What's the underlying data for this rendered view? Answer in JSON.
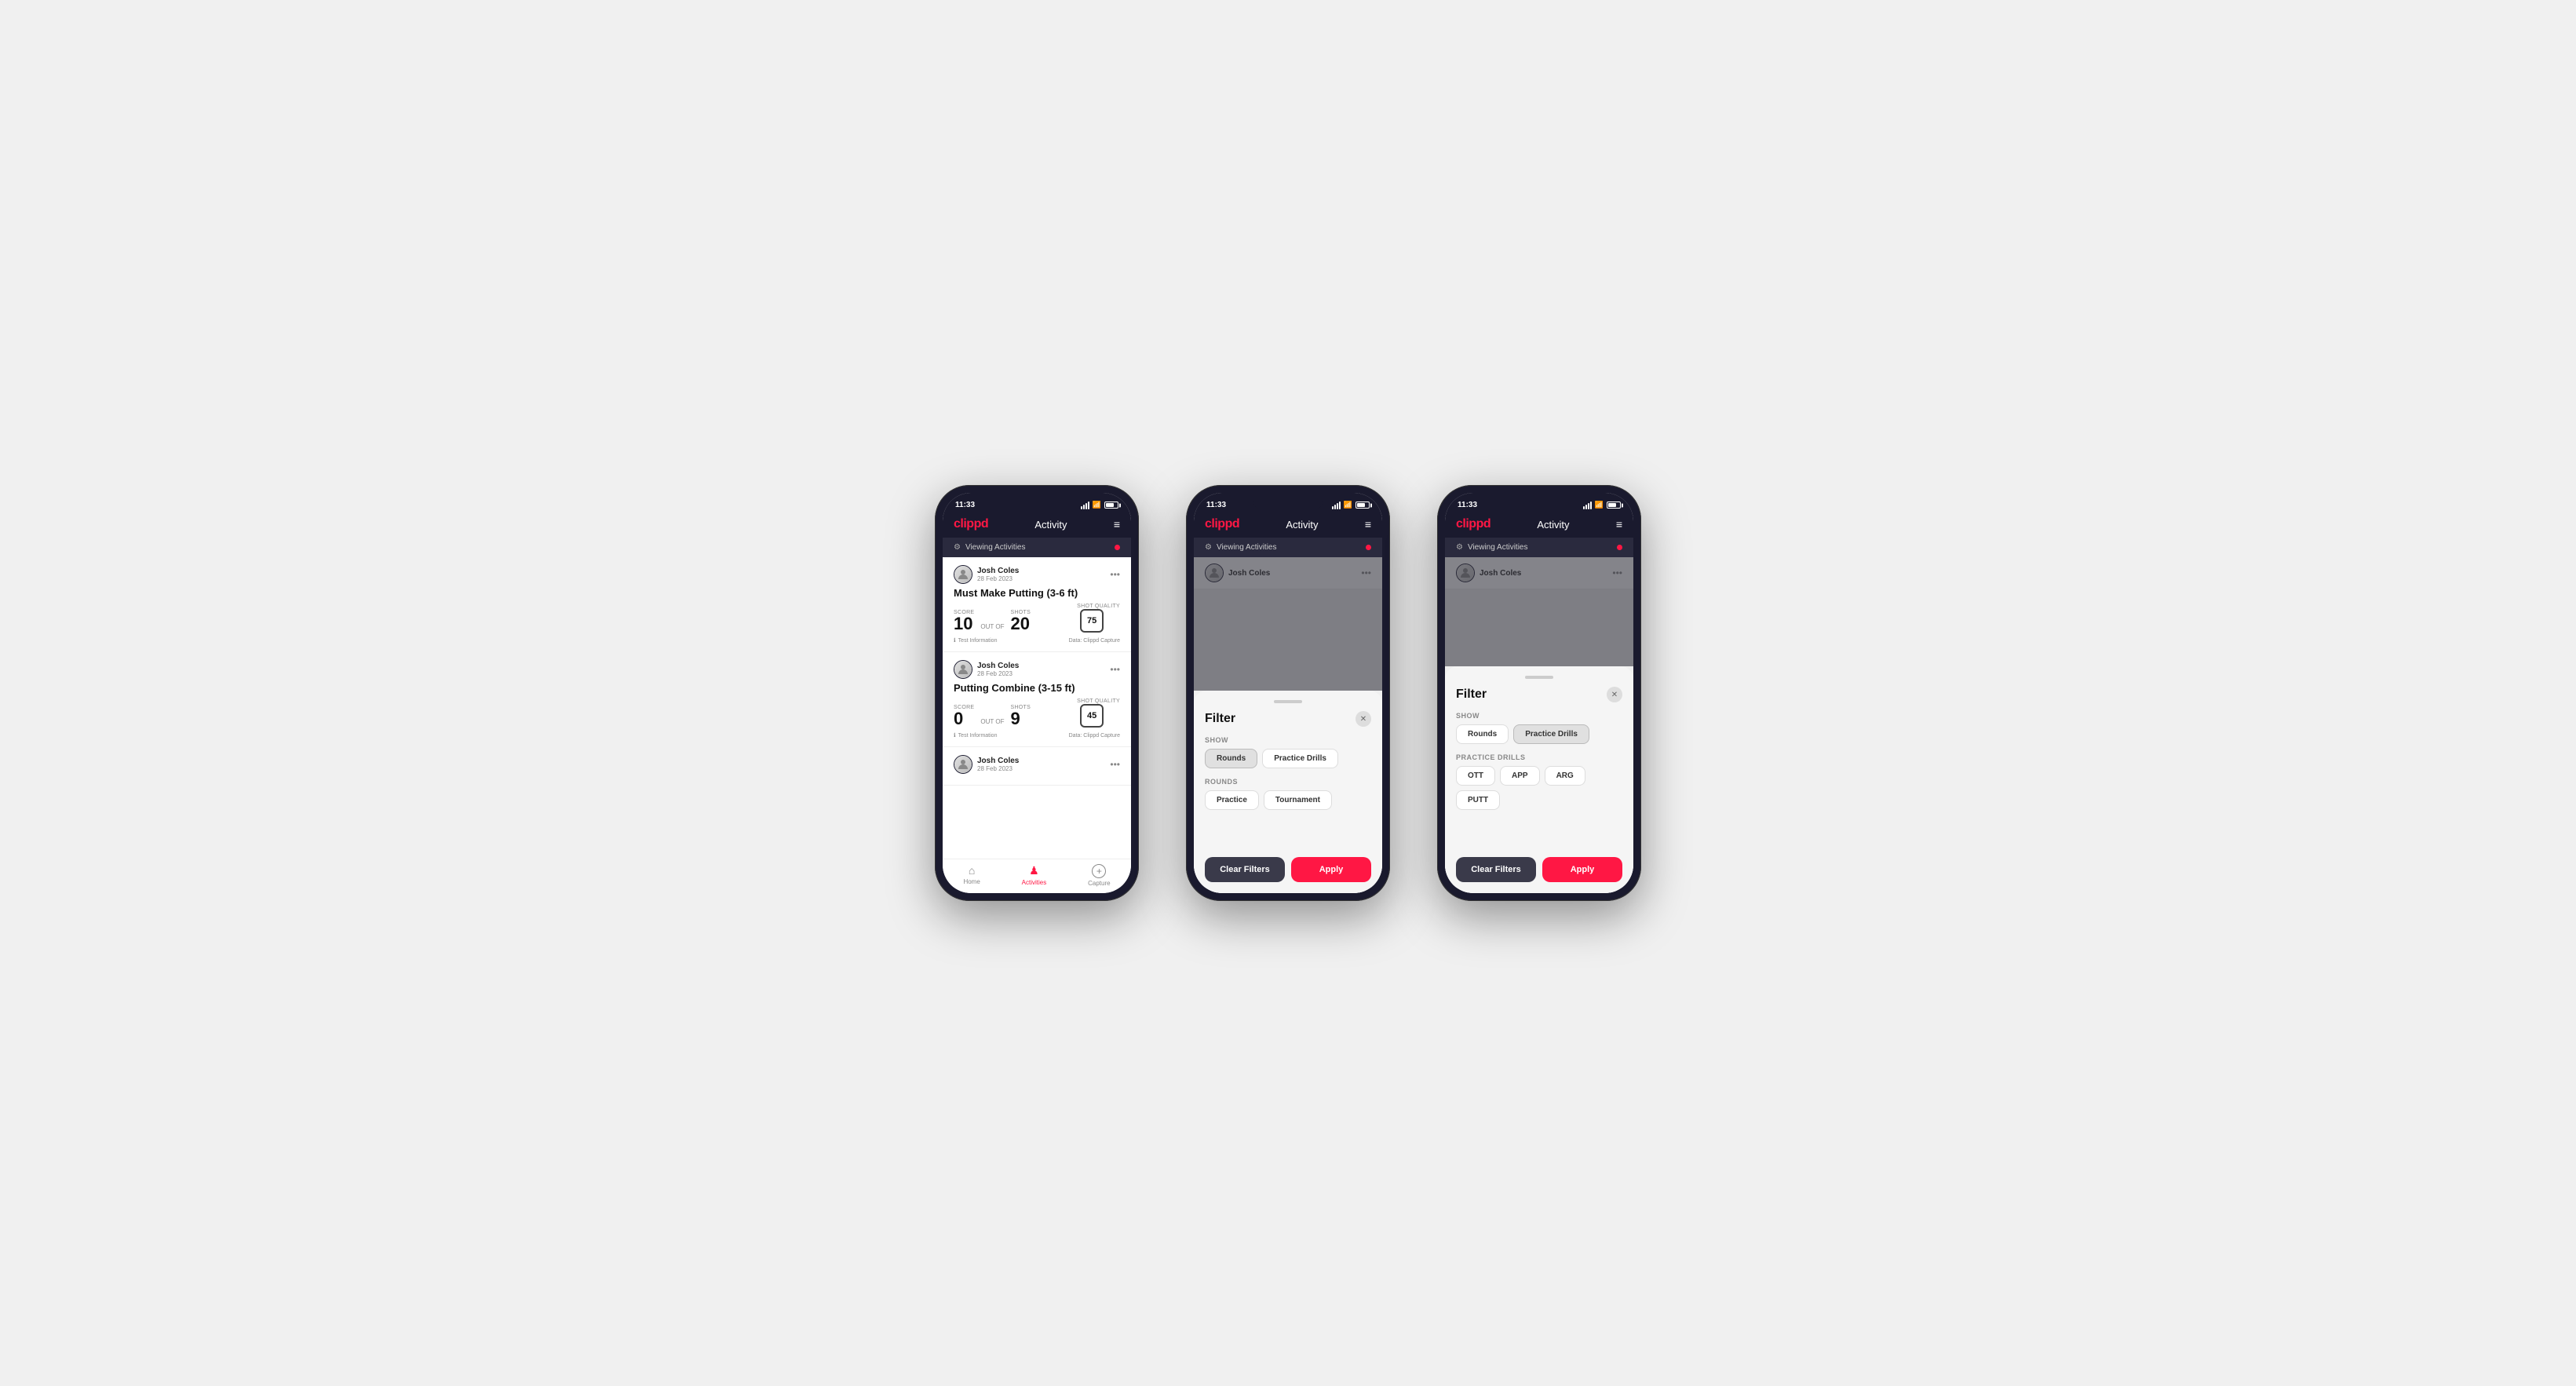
{
  "phones": [
    {
      "id": "phone1",
      "time": "11:33",
      "header": {
        "logo": "clippd",
        "title": "Activity",
        "menu": "≡"
      },
      "viewing_bar": "Viewing Activities",
      "activities": [
        {
          "user": "Josh Coles",
          "date": "28 Feb 2023",
          "title": "Must Make Putting (3-6 ft)",
          "score_label": "Score",
          "score_value": "10",
          "out_of_label": "OUT OF",
          "shots_label": "Shots",
          "shots_value": "20",
          "sq_label": "Shot Quality",
          "sq_value": "75",
          "footer_left": "Test Information",
          "footer_right": "Data: Clippd Capture"
        },
        {
          "user": "Josh Coles",
          "date": "28 Feb 2023",
          "title": "Putting Combine (3-15 ft)",
          "score_label": "Score",
          "score_value": "0",
          "out_of_label": "OUT OF",
          "shots_label": "Shots",
          "shots_value": "9",
          "sq_label": "Shot Quality",
          "sq_value": "45",
          "footer_left": "Test Information",
          "footer_right": "Data: Clippd Capture"
        },
        {
          "user": "Josh Coles",
          "date": "28 Feb 2023",
          "title": "",
          "score_label": "",
          "score_value": "",
          "out_of_label": "",
          "shots_label": "",
          "shots_value": "",
          "sq_label": "",
          "sq_value": "",
          "footer_left": "",
          "footer_right": ""
        }
      ],
      "nav": [
        {
          "label": "Home",
          "icon": "⌂",
          "active": false
        },
        {
          "label": "Activities",
          "icon": "♟",
          "active": true
        },
        {
          "label": "Capture",
          "icon": "+",
          "active": false
        }
      ]
    },
    {
      "id": "phone2",
      "time": "11:33",
      "header": {
        "logo": "clippd",
        "title": "Activity",
        "menu": "≡"
      },
      "viewing_bar": "Viewing Activities",
      "filter": {
        "title": "Filter",
        "show_label": "Show",
        "show_buttons": [
          {
            "label": "Rounds",
            "active": true
          },
          {
            "label": "Practice Drills",
            "active": false
          }
        ],
        "rounds_label": "Rounds",
        "rounds_buttons": [
          {
            "label": "Practice",
            "active": false
          },
          {
            "label": "Tournament",
            "active": false
          }
        ],
        "clear_label": "Clear Filters",
        "apply_label": "Apply"
      }
    },
    {
      "id": "phone3",
      "time": "11:33",
      "header": {
        "logo": "clippd",
        "title": "Activity",
        "menu": "≡"
      },
      "viewing_bar": "Viewing Activities",
      "filter": {
        "title": "Filter",
        "show_label": "Show",
        "show_buttons": [
          {
            "label": "Rounds",
            "active": false
          },
          {
            "label": "Practice Drills",
            "active": true
          }
        ],
        "drills_label": "Practice Drills",
        "drills_buttons": [
          {
            "label": "OTT",
            "active": false
          },
          {
            "label": "APP",
            "active": false
          },
          {
            "label": "ARG",
            "active": false
          },
          {
            "label": "PUTT",
            "active": false
          }
        ],
        "clear_label": "Clear Filters",
        "apply_label": "Apply"
      }
    }
  ]
}
